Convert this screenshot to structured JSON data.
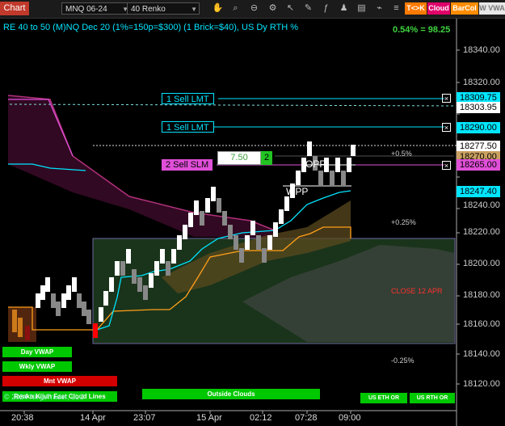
{
  "toolbar": {
    "chart_tab": "Chart",
    "instrument": "MNQ 06-24",
    "bar_type": "40 Renko",
    "btn_tk": "T<>K",
    "btn_cloud": "Cloud",
    "btn_barcol": "BarCol",
    "btn_vwa": "W VWA",
    "icons": [
      "hand-icon",
      "magnifier-icon",
      "magnifier-minus-icon",
      "chart-properties-icon",
      "cursor-icon",
      "draw-tools-icon",
      "indicator-icon",
      "strategy-icon",
      "template-icon",
      "attach-icon",
      "dom-icon"
    ]
  },
  "chart": {
    "title": "RE 40 to 50 (M)NQ Dec 20 (1%=150p=$300) (1 Brick=$40), US Dy RTH %",
    "pct_summary": "0.54% = 98.25",
    "price_axis": [
      "18340.00",
      "18320.00",
      "18300.00",
      "18280.00",
      "18260.00",
      "18240.00",
      "18220.00",
      "18200.00",
      "18180.00",
      "18160.00",
      "18140.00",
      "18120.00"
    ],
    "time_axis": [
      "20:38",
      "14 Apr",
      "23:07",
      "15 Apr",
      "02:12",
      "07:28",
      "09:00"
    ],
    "tags": {
      "p1": "18309.75",
      "p2": "18303.95",
      "p3": "18290.00",
      "p4": "18277.50",
      "p5": "18270.00",
      "p6": "18265.00",
      "p7": "18247.40"
    },
    "orders": {
      "sell_lmt_1": "1 Sell LMT",
      "sell_lmt_2": "1 Sell LMT",
      "sell_slm": "2 Sell SLM",
      "slm_price": "7.50",
      "slm_qty": "2"
    },
    "annotations": {
      "pct_plus_05": "+0.5%",
      "pct_plus_025": "+0.25%",
      "pct_minus_025": "-0.25%",
      "close_label": "CLOSE 12 APR",
      "opp": "OPP",
      "wpp": "WPP"
    },
    "buttons": {
      "day_vwap": "Day VWAP",
      "wkly_vwap": "Wkly VWAP",
      "mnt_vwap": "Mnt VWAP",
      "renko_kijun": "Renko Kijun Fast Cloud Lines",
      "outside_clouds": "Outside Clouds",
      "us_eth_or": "US ETH OR",
      "us_rth_or": "US RTH OR"
    },
    "copyright": "© 2024 NinjaTrader, LLC",
    "colors": {
      "up_brick": "#ffffff",
      "down_brick": "#808080",
      "cyan": "#00e5ff",
      "magenta": "#e04fd8",
      "orange": "#ff9f1a",
      "green": "#00c800",
      "red": "#d40000"
    }
  }
}
